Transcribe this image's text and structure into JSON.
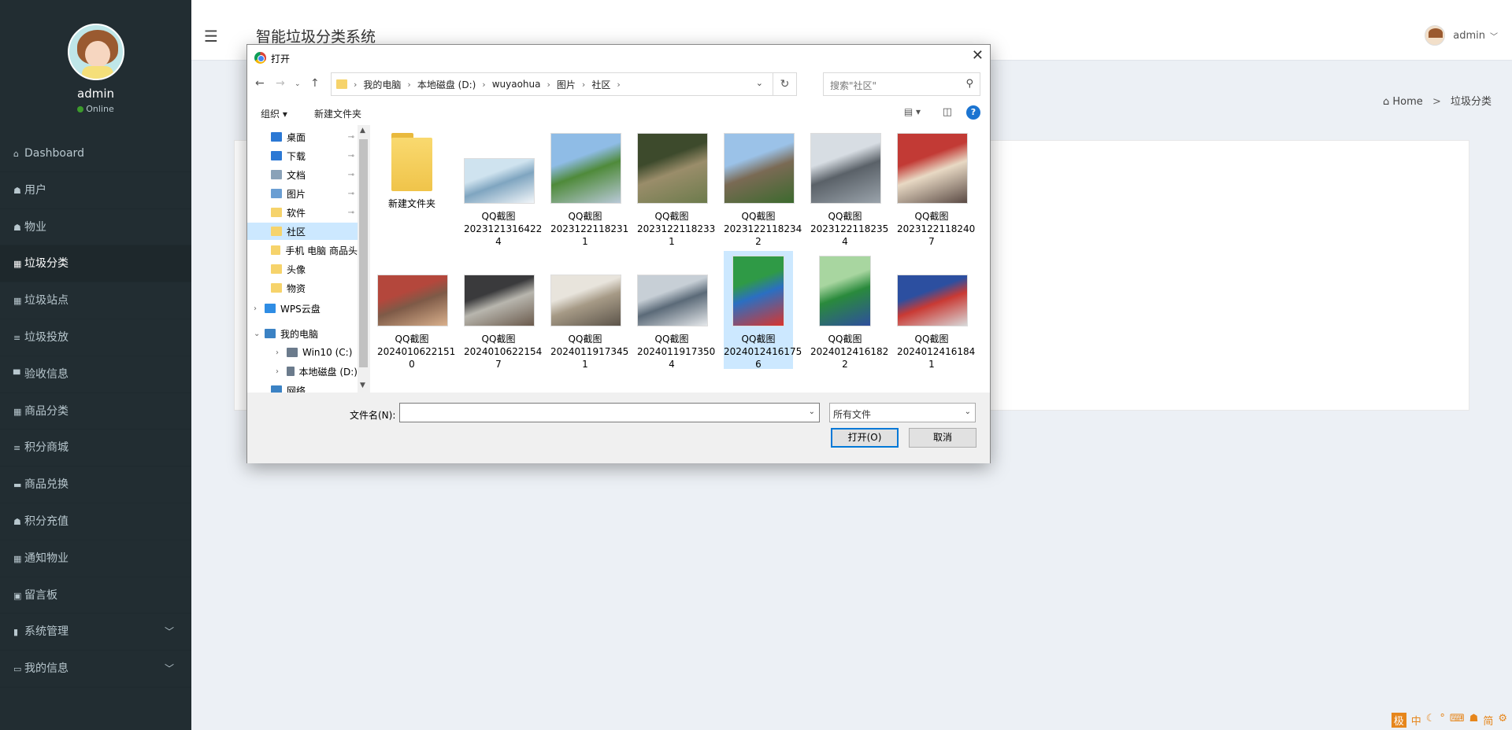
{
  "sidebar": {
    "username": "admin",
    "status": "Online",
    "items": [
      {
        "icon": "home-icon",
        "glyph": "⌂",
        "label": "Dashboard"
      },
      {
        "icon": "user-group-icon",
        "glyph": "☗",
        "label": "用户"
      },
      {
        "icon": "user-icon",
        "glyph": "☗",
        "label": "物业"
      },
      {
        "icon": "grid-icon",
        "glyph": "▦",
        "label": "垃圾分类"
      },
      {
        "icon": "grid-icon",
        "glyph": "▦",
        "label": "垃圾站点"
      },
      {
        "icon": "list-icon",
        "glyph": "≡",
        "label": "垃圾投放"
      },
      {
        "icon": "monitor-icon",
        "glyph": "▀",
        "label": "验收信息"
      },
      {
        "icon": "table-icon",
        "glyph": "▦",
        "label": "商品分类"
      },
      {
        "icon": "list-icon",
        "glyph": "≡",
        "label": "积分商城"
      },
      {
        "icon": "card-icon",
        "glyph": "▬",
        "label": "商品兑换"
      },
      {
        "icon": "user-icon",
        "glyph": "☗",
        "label": "积分充值"
      },
      {
        "icon": "grid-icon",
        "glyph": "▦",
        "label": "通知物业"
      },
      {
        "icon": "clipboard-icon",
        "glyph": "▣",
        "label": "留言板"
      },
      {
        "icon": "bar-chart-icon",
        "glyph": "▮",
        "label": "系统管理"
      },
      {
        "icon": "calendar-icon",
        "glyph": "▭",
        "label": "我的信息"
      }
    ]
  },
  "header": {
    "title": "智能垃圾分类系统",
    "user": "admin"
  },
  "breadcrumb": {
    "home": "Home",
    "current": "垃圾分类"
  },
  "dialog": {
    "title": "打开",
    "address": [
      "我的电脑",
      "本地磁盘 (D:)",
      "wuyaohua",
      "图片",
      "社区"
    ],
    "search_placeholder": "搜索\"社区\"",
    "toolbar": {
      "organize": "组织 ▾",
      "new_folder": "新建文件夹"
    },
    "tree": [
      {
        "label": "桌面",
        "color": "#2b78d4",
        "pinned": true
      },
      {
        "label": "下载",
        "color": "#2b78d4",
        "pinned": true
      },
      {
        "label": "文档",
        "color": "#8aa2b8",
        "pinned": true
      },
      {
        "label": "图片",
        "color": "#6a9ed3",
        "pinned": true
      },
      {
        "label": "软件",
        "color": "#f6d36b",
        "pinned": true
      },
      {
        "label": "社区",
        "color": "#f6d36b",
        "pinned": false
      },
      {
        "label": "手机 电脑 商品头",
        "color": "#f6d36b",
        "pinned": false
      },
      {
        "label": "头像",
        "color": "#f6d36b",
        "pinned": false
      },
      {
        "label": "物资",
        "color": "#f6d36b",
        "pinned": false
      },
      {
        "label": "WPS云盘",
        "color": "#2f8de4",
        "pinned": false
      },
      {
        "label": "我的电脑",
        "color": "#3b82c4",
        "pinned": false
      },
      {
        "label": "Win10 (C:)",
        "color": "#6b7b8c",
        "pinned": false
      },
      {
        "label": "本地磁盘 (D:)",
        "color": "#6b7b8c",
        "pinned": false
      },
      {
        "label": "网络",
        "color": "#3b82c4",
        "pinned": false
      }
    ],
    "files": [
      {
        "name1": "新建文件夹",
        "name2": "",
        "type": "folder"
      },
      {
        "name1": "QQ截图",
        "name2": "20231213164224",
        "type": "image",
        "colors": [
          "#cfe3ef",
          "#7fa5c0",
          "#f2f6f9"
        ]
      },
      {
        "name1": "QQ截图",
        "name2": "20231221182311",
        "type": "image",
        "colors": [
          "#8fbce6",
          "#4f8a3a",
          "#b9c9d8"
        ]
      },
      {
        "name1": "QQ截图",
        "name2": "20231221182331",
        "type": "image",
        "colors": [
          "#3d4a2c",
          "#9a8d6a",
          "#6c7b4c"
        ]
      },
      {
        "name1": "QQ截图",
        "name2": "20231221182342",
        "type": "image",
        "colors": [
          "#9bc2e8",
          "#7a6a54",
          "#3c6a2e"
        ]
      },
      {
        "name1": "QQ截图",
        "name2": "20231221182354",
        "type": "image",
        "colors": [
          "#d7dde3",
          "#5a6168",
          "#9aa3ab"
        ]
      },
      {
        "name1": "QQ截图",
        "name2": "20231221182407",
        "type": "image",
        "colors": [
          "#c23a35",
          "#e8d9c4",
          "#5a4a44"
        ]
      },
      {
        "name1": "QQ截图",
        "name2": "20240106221510",
        "type": "image",
        "colors": [
          "#b4473c",
          "#7e5a47",
          "#d9b08c"
        ]
      },
      {
        "name1": "QQ截图",
        "name2": "20240106221547",
        "type": "image",
        "colors": [
          "#3a3a3c",
          "#b8b6ae",
          "#6a5a4c"
        ]
      },
      {
        "name1": "QQ截图",
        "name2": "20240119173451",
        "type": "image",
        "colors": [
          "#e8e4dc",
          "#a69a86",
          "#5c544a"
        ]
      },
      {
        "name1": "QQ截图",
        "name2": "20240119173504",
        "type": "image",
        "colors": [
          "#c7cfd6",
          "#5b6a78",
          "#e5e8eb"
        ]
      },
      {
        "name1": "QQ截图",
        "name2": "20240124161756",
        "type": "image",
        "colors": [
          "#2f9a46",
          "#2b6fc2",
          "#d8352e"
        ]
      },
      {
        "name1": "QQ截图",
        "name2": "20240124161822",
        "type": "image",
        "colors": [
          "#a8d6a0",
          "#2a8a3c",
          "#2e4f9e"
        ]
      },
      {
        "name1": "QQ截图",
        "name2": "20240124161841",
        "type": "image",
        "colors": [
          "#2c4fa0",
          "#c93a34",
          "#d8d8d8"
        ]
      }
    ],
    "filename_label": "文件名(N):",
    "filename_value": "",
    "filetype": "所有文件",
    "open_btn": "打开(O)",
    "cancel_btn": "取消"
  },
  "ime": [
    "中",
    "☾",
    "°",
    "⌨",
    "☗",
    "简",
    "⚙"
  ],
  "ime_logo": "极"
}
